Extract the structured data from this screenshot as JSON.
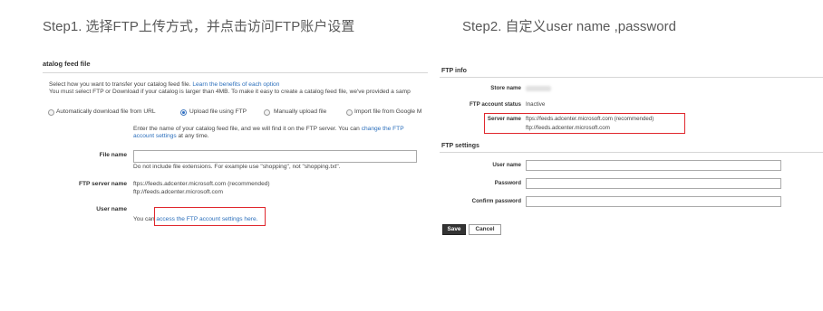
{
  "step1": {
    "title": "Step1. 选择FTP上传方式，并点击访问FTP账户设置"
  },
  "step2": {
    "title": "Step2. 自定义user name ,password"
  },
  "catalog": {
    "heading": "atalog feed file",
    "intro_text": "Select how you want to transfer your catalog feed file. ",
    "intro_link": "Learn the benefits of each option",
    "size_note": "You must select FTP or Download if your catalog is larger than 4MB. To make it easy to create a catalog feed file, we've provided a samp",
    "options": [
      {
        "label": "Automatically download file from URL",
        "selected": false
      },
      {
        "label": "Upload file using FTP",
        "selected": true
      },
      {
        "label": "Manually upload file",
        "selected": false
      },
      {
        "label": "Import file from Google M",
        "selected": false
      }
    ],
    "ftp_hint": {
      "line1_text": "Enter the name of your catalog feed file, and we will find it on the FTP server. You can ",
      "line1_link": "change the FTP",
      "line2_link": "account settings",
      "line2_text": " at any time."
    },
    "file_name": {
      "label": "File name",
      "value": "",
      "hint": "Do not include file extensions. For example use \"shopping\", not \"shopping.txt\"."
    },
    "ftp_server": {
      "label": "FTP server name",
      "values": [
        "ftps://feeds.adcenter.microsoft.com (recommended)",
        "ftp://feeds.adcenter.microsoft.com"
      ]
    },
    "user_name": {
      "label": "User name",
      "text": "You can ",
      "link": "access the FTP account settings here."
    }
  },
  "ftp_info": {
    "heading": "FTP info",
    "store_name": {
      "label": "Store name"
    },
    "account_status": {
      "label": "FTP account status",
      "value": "Inactive"
    },
    "server_name": {
      "label": "Server name",
      "values": [
        "ftps://feeds.adcenter.microsoft.com (recommended)",
        "ftp://feeds.adcenter.microsoft.com"
      ]
    }
  },
  "ftp_settings": {
    "heading": "FTP settings",
    "user_name": {
      "label": "User name",
      "value": ""
    },
    "password": {
      "label": "Password",
      "value": ""
    },
    "confirm_password": {
      "label": "Confirm password",
      "value": ""
    }
  },
  "actions": {
    "save": "Save",
    "cancel": "Cancel"
  },
  "colors": {
    "step_title": "#595959",
    "link": "#2a6ebb",
    "highlight_box": "#e0282e",
    "save_button": "#333333"
  }
}
